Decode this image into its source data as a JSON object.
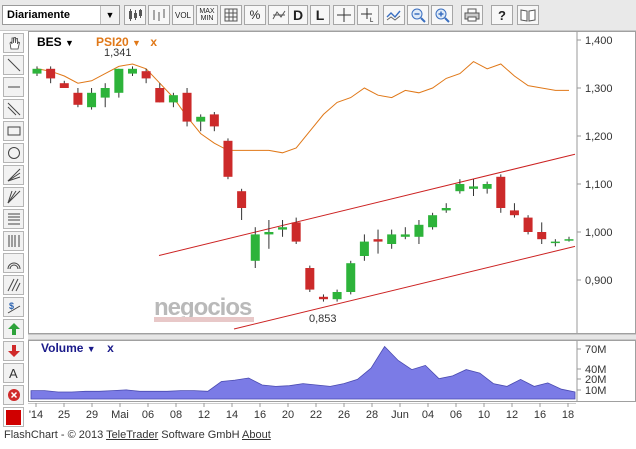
{
  "toolbar": {
    "period_label": "Diariamente",
    "dropdown_arrow": "▼",
    "buttons": [
      "VOL",
      "MAX\nMIN",
      "%",
      "D",
      "L",
      "+",
      "?"
    ],
    "vol_label": "VOL",
    "maxmin_top": "MAX",
    "maxmin_bottom": "MIN",
    "pct_label": "%",
    "d_label": "D",
    "l_label": "L",
    "help_label": "?"
  },
  "legend": {
    "primary": "BES",
    "primary_arrow": "▼",
    "compare": "PSI20",
    "compare_arrow": "▼",
    "remove": "x",
    "max_label": "1,341",
    "min_label": "0,853",
    "volume": "Volume",
    "volume_arrow": "▼",
    "volume_remove": "x"
  },
  "watermark": {
    "brand": "negocios",
    "sub": "PORTUGAL"
  },
  "footer": {
    "prefix": "FlashChart - © 2013 ",
    "company": "TeleTrader",
    "middle": " Software GmbH ",
    "about": "About"
  },
  "colors": {
    "up": "#2db33a",
    "down": "#cc2a2a",
    "compare": "#e07818",
    "trend": "#cc2222",
    "volume": "#7b7be6"
  },
  "chart_data": {
    "type": "candlestick",
    "x_ticks": [
      "'14",
      "25",
      "29",
      "Mai",
      "06",
      "08",
      "12",
      "14",
      "16",
      "20",
      "22",
      "26",
      "28",
      "Jun",
      "04",
      "06",
      "10",
      "12",
      "16",
      "18"
    ],
    "y_ticks": [
      "1,400",
      "1,300",
      "1,200",
      "1,100",
      "1,000",
      "0,900"
    ],
    "ylim": [
      0.8,
      1.4
    ],
    "volume_ticks": [
      "70M",
      "40M",
      "20M",
      "10M"
    ],
    "candles": [
      {
        "o": 1.33,
        "h": 1.345,
        "l": 1.325,
        "c": 1.34
      },
      {
        "o": 1.34,
        "h": 1.345,
        "l": 1.31,
        "c": 1.32
      },
      {
        "o": 1.31,
        "h": 1.315,
        "l": 1.3,
        "c": 1.3
      },
      {
        "o": 1.29,
        "h": 1.3,
        "l": 1.26,
        "c": 1.265
      },
      {
        "o": 1.26,
        "h": 1.3,
        "l": 1.255,
        "c": 1.29
      },
      {
        "o": 1.28,
        "h": 1.31,
        "l": 1.26,
        "c": 1.3
      },
      {
        "o": 1.29,
        "h": 1.34,
        "l": 1.28,
        "c": 1.34
      },
      {
        "o": 1.33,
        "h": 1.345,
        "l": 1.325,
        "c": 1.34
      },
      {
        "o": 1.335,
        "h": 1.34,
        "l": 1.31,
        "c": 1.32
      },
      {
        "o": 1.3,
        "h": 1.31,
        "l": 1.27,
        "c": 1.27
      },
      {
        "o": 1.27,
        "h": 1.29,
        "l": 1.26,
        "c": 1.285
      },
      {
        "o": 1.29,
        "h": 1.3,
        "l": 1.22,
        "c": 1.23
      },
      {
        "o": 1.23,
        "h": 1.245,
        "l": 1.21,
        "c": 1.24
      },
      {
        "o": 1.245,
        "h": 1.25,
        "l": 1.21,
        "c": 1.22
      },
      {
        "o": 1.19,
        "h": 1.195,
        "l": 1.11,
        "c": 1.115
      },
      {
        "o": 1.085,
        "h": 1.09,
        "l": 1.025,
        "c": 1.05
      },
      {
        "o": 0.94,
        "h": 1.01,
        "l": 0.925,
        "c": 0.995
      },
      {
        "o": 0.995,
        "h": 1.025,
        "l": 0.965,
        "c": 1.0
      },
      {
        "o": 1.005,
        "h": 1.025,
        "l": 0.99,
        "c": 1.01
      },
      {
        "o": 1.02,
        "h": 1.03,
        "l": 0.975,
        "c": 0.98
      },
      {
        "o": 0.925,
        "h": 0.93,
        "l": 0.875,
        "c": 0.88
      },
      {
        "o": 0.865,
        "h": 0.87,
        "l": 0.855,
        "c": 0.86
      },
      {
        "o": 0.86,
        "h": 0.88,
        "l": 0.855,
        "c": 0.875
      },
      {
        "o": 0.875,
        "h": 0.94,
        "l": 0.87,
        "c": 0.935
      },
      {
        "o": 0.95,
        "h": 0.995,
        "l": 0.94,
        "c": 0.98
      },
      {
        "o": 0.985,
        "h": 1.005,
        "l": 0.955,
        "c": 0.98
      },
      {
        "o": 0.975,
        "h": 1.005,
        "l": 0.965,
        "c": 0.995
      },
      {
        "o": 0.99,
        "h": 1.01,
        "l": 0.985,
        "c": 0.995
      },
      {
        "o": 0.99,
        "h": 1.025,
        "l": 0.975,
        "c": 1.015
      },
      {
        "o": 1.01,
        "h": 1.04,
        "l": 1.005,
        "c": 1.035
      },
      {
        "o": 1.045,
        "h": 1.06,
        "l": 1.04,
        "c": 1.05
      },
      {
        "o": 1.085,
        "h": 1.11,
        "l": 1.08,
        "c": 1.1
      },
      {
        "o": 1.09,
        "h": 1.11,
        "l": 1.075,
        "c": 1.095
      },
      {
        "o": 1.09,
        "h": 1.105,
        "l": 1.08,
        "c": 1.1
      },
      {
        "o": 1.115,
        "h": 1.12,
        "l": 1.04,
        "c": 1.05
      },
      {
        "o": 1.045,
        "h": 1.06,
        "l": 1.03,
        "c": 1.035
      },
      {
        "o": 1.03,
        "h": 1.035,
        "l": 0.995,
        "c": 1.0
      },
      {
        "o": 1.0,
        "h": 1.02,
        "l": 0.975,
        "c": 0.985
      },
      {
        "o": 0.98,
        "h": 0.985,
        "l": 0.97,
        "c": 0.98
      },
      {
        "o": 0.985,
        "h": 0.99,
        "l": 0.98,
        "c": 0.985
      }
    ],
    "compare_series": [
      1.34,
      1.335,
      1.325,
      1.31,
      1.315,
      1.33,
      1.345,
      1.35,
      1.34,
      1.31,
      1.28,
      1.24,
      1.205,
      1.185,
      1.17,
      1.17,
      1.17,
      1.17,
      1.165,
      1.175,
      1.21,
      1.245,
      1.27,
      1.28,
      1.3,
      1.285,
      1.28,
      1.295,
      1.29,
      1.3,
      1.32,
      1.33,
      1.355,
      1.34,
      1.35,
      1.325,
      1.305,
      1.3,
      1.295,
      1.295
    ],
    "volume_values": [
      12,
      12,
      10,
      10,
      11,
      11,
      12,
      13,
      11,
      11,
      11,
      12,
      12,
      11,
      25,
      27,
      30,
      20,
      18,
      19,
      22,
      20,
      18,
      22,
      28,
      44,
      75,
      55,
      42,
      48,
      29,
      33,
      42,
      37,
      22,
      18,
      28,
      18,
      23,
      14,
      10
    ]
  }
}
